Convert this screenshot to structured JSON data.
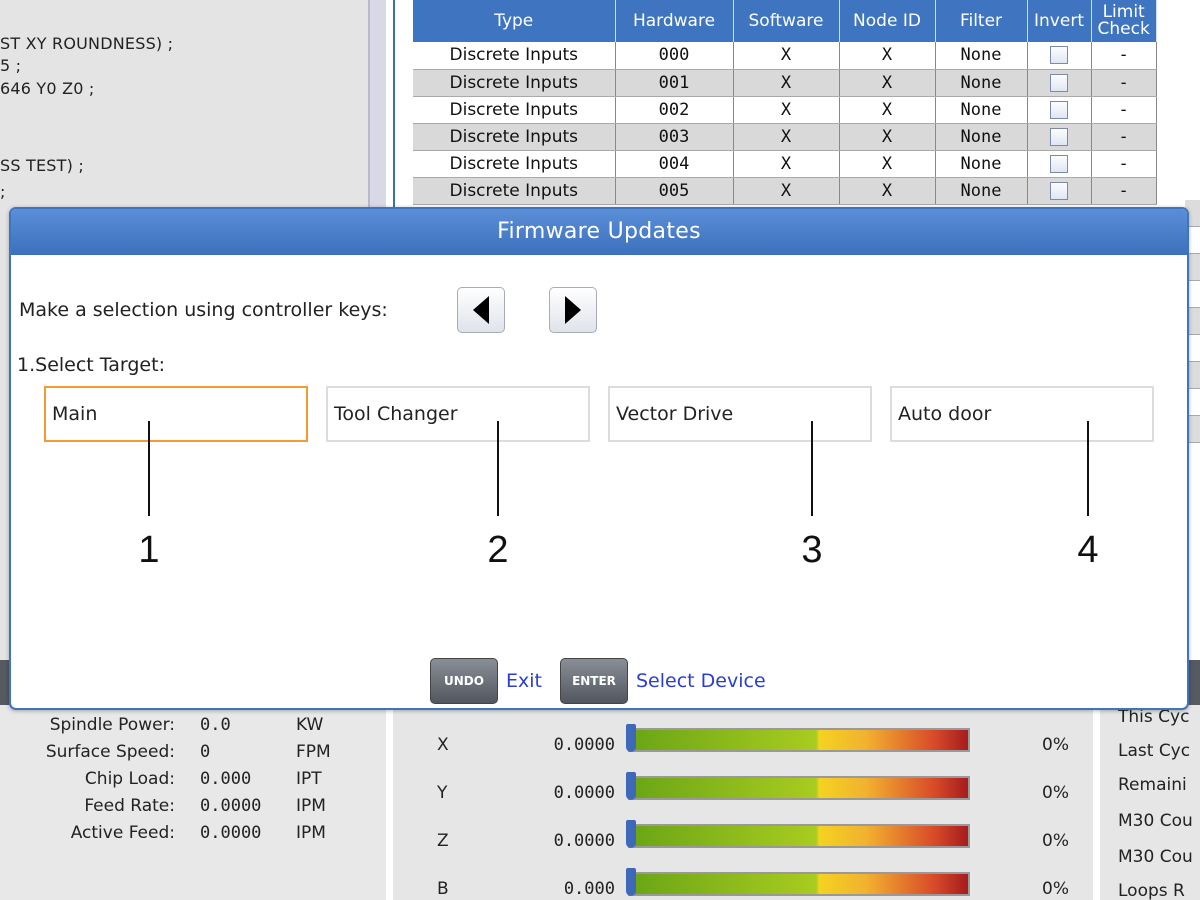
{
  "program": {
    "lines": [
      "ST XY ROUNDNESS) ;",
      "5 ;",
      "646 Y0 Z0 ;",
      "SS TEST) ;",
      ";"
    ]
  },
  "io_table": {
    "headers": [
      "Type",
      "Hardware",
      "Software",
      "Node ID",
      "Filter",
      "Invert",
      "Limit Check"
    ],
    "rows": [
      {
        "type": "Discrete Inputs",
        "hardware": "000",
        "software": "X",
        "node": "X",
        "filter": "None",
        "limit": "-"
      },
      {
        "type": "Discrete Inputs",
        "hardware": "001",
        "software": "X",
        "node": "X",
        "filter": "None",
        "limit": "-"
      },
      {
        "type": "Discrete Inputs",
        "hardware": "002",
        "software": "X",
        "node": "X",
        "filter": "None",
        "limit": "-"
      },
      {
        "type": "Discrete Inputs",
        "hardware": "003",
        "software": "X",
        "node": "X",
        "filter": "None",
        "limit": "-"
      },
      {
        "type": "Discrete Inputs",
        "hardware": "004",
        "software": "X",
        "node": "X",
        "filter": "None",
        "limit": "-"
      },
      {
        "type": "Discrete Inputs",
        "hardware": "005",
        "software": "X",
        "node": "X",
        "filter": "None",
        "limit": "-"
      }
    ]
  },
  "spindle": {
    "items": [
      {
        "label": "Spindle Power:",
        "value": "0.0",
        "unit": "KW"
      },
      {
        "label": "Surface Speed:",
        "value": "0",
        "unit": "FPM"
      },
      {
        "label": "Chip Load:",
        "value": "0.000",
        "unit": "IPT"
      },
      {
        "label": "Feed Rate:",
        "value": "0.0000",
        "unit": "IPM"
      },
      {
        "label": "Active Feed:",
        "value": "0.0000",
        "unit": "IPM"
      }
    ]
  },
  "axes": [
    {
      "name": "X",
      "position": "0.0000",
      "load": "0%",
      "load_fraction": 0
    },
    {
      "name": "Y",
      "position": "0.0000",
      "load": "0%",
      "load_fraction": 0
    },
    {
      "name": "Z",
      "position": "0.0000",
      "load": "0%",
      "load_fraction": 0
    },
    {
      "name": "B",
      "position": "0.000",
      "load": "0%",
      "load_fraction": 0
    }
  ],
  "cycle": {
    "items": [
      "This Cyc",
      "Last Cyc",
      "Remaini",
      "M30 Cou",
      "M30 Cou",
      "Loops R"
    ]
  },
  "modal": {
    "title": "Firmware Updates",
    "instruction": "Make a selection using controller keys:",
    "step": "1.Select Target:",
    "targets": [
      "Main",
      "Tool Changer",
      "Vector Drive",
      "Auto door"
    ],
    "selected_index": 0,
    "callouts": [
      "1",
      "2",
      "3",
      "4"
    ],
    "undo_key": "UNDO",
    "undo_text": "Exit",
    "enter_key": "ENTER",
    "enter_text": "Select Device"
  },
  "colors": {
    "accent": "#3f74c0",
    "selected_border": "#f39a35",
    "link": "#2a3fcf"
  }
}
